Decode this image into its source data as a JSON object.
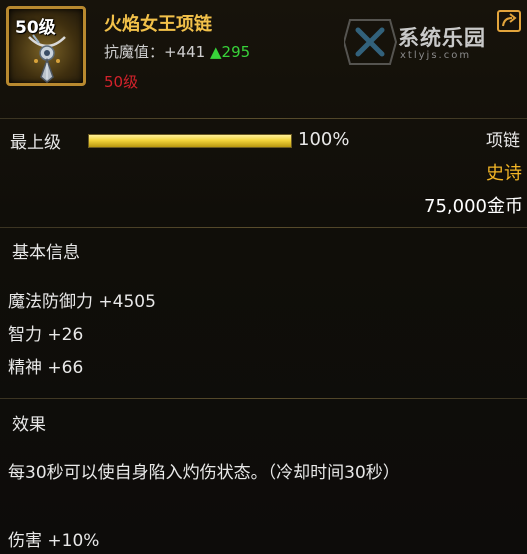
{
  "item": {
    "level_badge": "50级",
    "name": "火焰女王项链",
    "stat_label": "抗魔值：+441",
    "stat_bonus": "▲295",
    "required_level": "50级",
    "art_icon": "necklace-icon",
    "colors": {
      "name": "#f2c14a",
      "bonus": "#38d33a",
      "required_level": "#d3222b",
      "rarity": "#f1b426"
    }
  },
  "share": {
    "icon": "share-icon"
  },
  "watermark": {
    "text": "系统乐园",
    "sub": "xtlyjs.com"
  },
  "grade": {
    "label": "最上级",
    "percent_text": "100%",
    "percent": 100,
    "type": "项链",
    "rarity": "史诗",
    "price": "75,000金币"
  },
  "basic_info": {
    "title": "基本信息",
    "attributes": [
      "魔法防御力 +4505",
      "智力 +26",
      "精神 +66"
    ]
  },
  "effect": {
    "title": "效果",
    "description": "每30秒可以使自身陷入灼伤状态。（冷却时间30秒）",
    "damage": "伤害 +10%"
  }
}
